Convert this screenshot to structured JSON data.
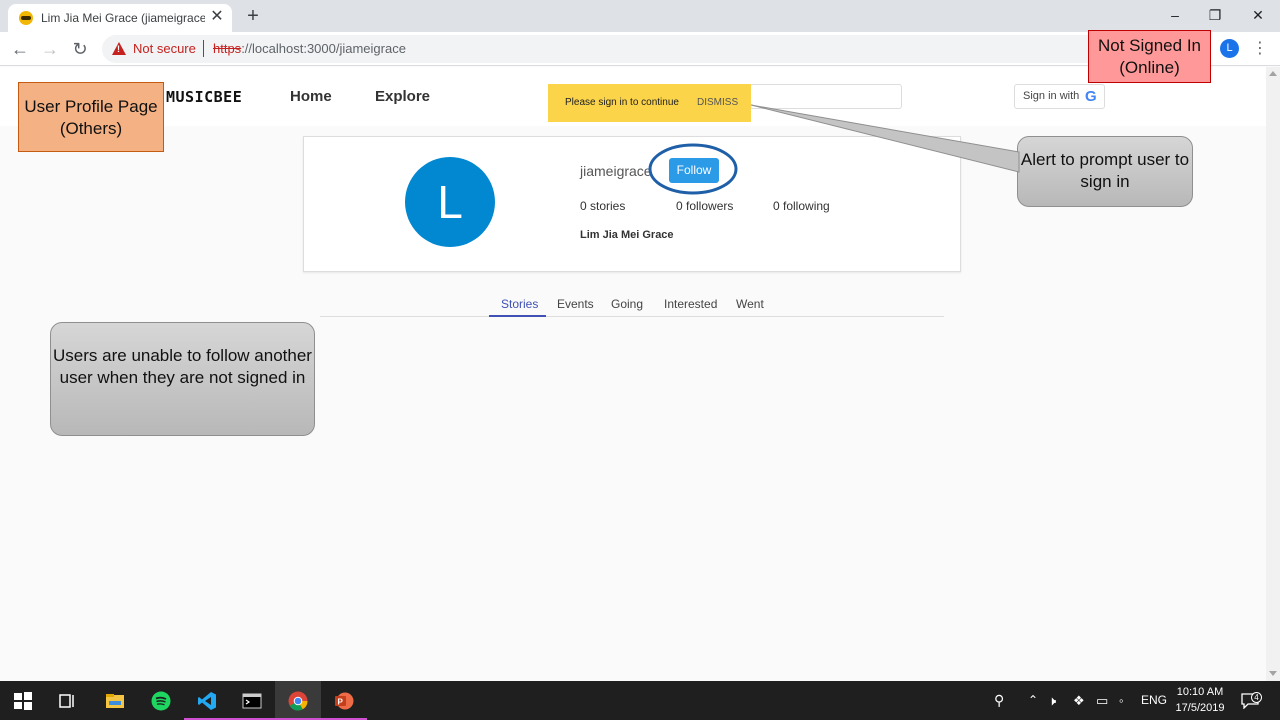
{
  "browser": {
    "tab_title": "Lim Jia Mei Grace (jiameigrace) - ",
    "tab_close": "✕",
    "new_tab": "+",
    "window_minimize": "–",
    "window_restore": "❐",
    "window_close": "✕",
    "back": "←",
    "forward": "→",
    "reload": "↻",
    "security_label": "Not secure",
    "url_scheme": "https",
    "url_rest": "://localhost:3000/jiameigrace",
    "profile_initial": "L",
    "menu": "⋮"
  },
  "site": {
    "logo": "MUSICBEE",
    "nav": {
      "home": "Home",
      "explore": "Explore"
    },
    "sign_in_label": "Sign in with",
    "google_glyph": "G"
  },
  "alert": {
    "message": "Please sign in to continue",
    "dismiss": "DISMISS"
  },
  "profile": {
    "avatar_initial": "L",
    "username": "jiameigrace",
    "follow_label": "Follow",
    "stats": {
      "stories": "0 stories",
      "followers": "0 followers",
      "following": "0 following"
    },
    "full_name": "Lim Jia Mei Grace"
  },
  "profile_tabs": {
    "active": "Stories",
    "items": [
      "Stories",
      "Events",
      "Going",
      "Interested",
      "Went"
    ]
  },
  "annotations": {
    "page_label": "User Profile Page (Others)",
    "status_label": "Not Signed In (Online)",
    "alert_note": "Alert to prompt user to sign in",
    "follow_note": "Users are unable to follow another user when they are not signed in"
  },
  "taskbar": {
    "language": "ENG",
    "time": "10:10 AM",
    "date": "17/5/2019",
    "notification_count": "4"
  },
  "colors": {
    "accent_blue": "#2b9be8",
    "avatar_blue": "#0288d1",
    "alert_yellow": "#fbd449",
    "active_tab": "#3f51b5",
    "callout_ring": "#1f5fa8"
  }
}
